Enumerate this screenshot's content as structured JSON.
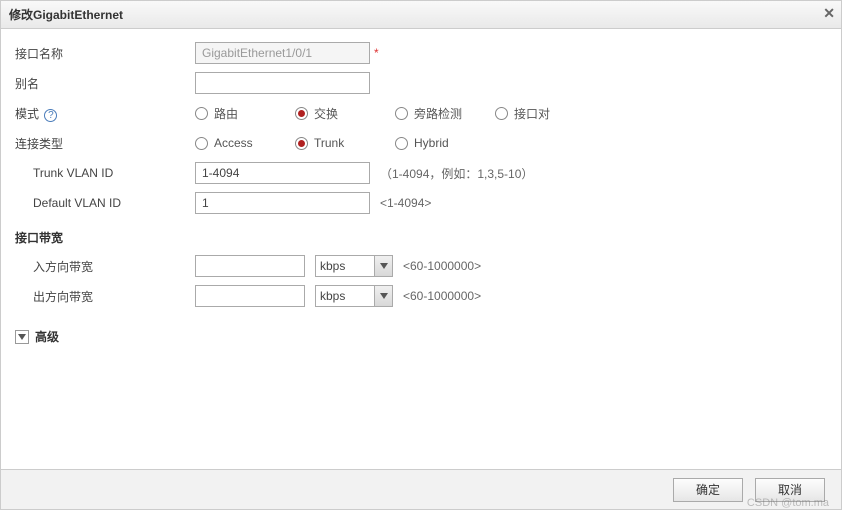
{
  "dialog": {
    "title": "修改GigabitEthernet"
  },
  "fields": {
    "ifname": {
      "label": "接口名称",
      "value": "GigabitEthernet1/0/1",
      "required_mark": "*"
    },
    "alias": {
      "label": "别名",
      "value": ""
    },
    "mode": {
      "label": "模式",
      "options": {
        "route": "路由",
        "switch": "交换",
        "loopdetect": "旁路检测",
        "ifpair": "接口对"
      },
      "selected": "switch"
    },
    "linktype": {
      "label": "连接类型",
      "options": {
        "access": "Access",
        "trunk": "Trunk",
        "hybrid": "Hybrid"
      },
      "selected": "trunk"
    },
    "trunk_vlan": {
      "label": "Trunk VLAN ID",
      "value": "1-4094",
      "hint": "（1-4094，例如：1,3,5-10）"
    },
    "default_vlan": {
      "label": "Default VLAN ID",
      "value": "1",
      "hint": "<1-4094>"
    }
  },
  "bandwidth": {
    "section": "接口带宽",
    "in": {
      "label": "入方向带宽",
      "value": "",
      "unit": "kbps",
      "hint": "<60-1000000>"
    },
    "out": {
      "label": "出方向带宽",
      "value": "",
      "unit": "kbps",
      "hint": "<60-1000000>"
    }
  },
  "advanced": {
    "label": "高级"
  },
  "footer": {
    "ok": "确定",
    "cancel": "取消"
  },
  "watermark": "CSDN @tom.ma"
}
